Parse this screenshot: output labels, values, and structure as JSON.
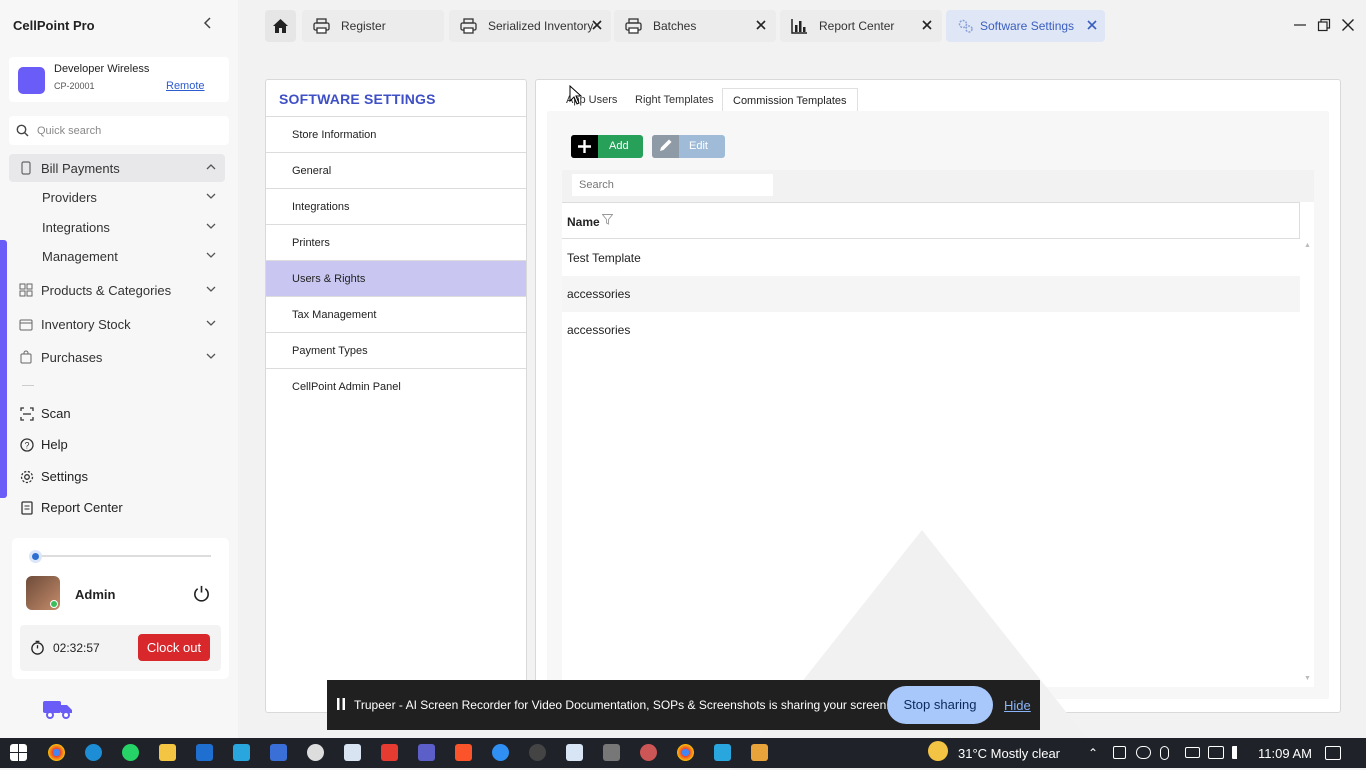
{
  "app": {
    "title": "CellPoint Pro"
  },
  "store": {
    "name": "Developer Wireless",
    "id": "CP-20001",
    "mode_link": "Remote"
  },
  "search": {
    "placeholder": "Quick search"
  },
  "nav": {
    "bill_payments": "Bill Payments",
    "providers": "Providers",
    "integrations": "Integrations",
    "management": "Management",
    "products": "Products & Categories",
    "inventory": "Inventory Stock",
    "purchases": "Purchases",
    "scan": "Scan",
    "help": "Help",
    "settings": "Settings",
    "report_center": "Report Center"
  },
  "user": {
    "name": "Admin",
    "timer": "02:32:57",
    "clock_out": "Clock out",
    "progress": 0.0
  },
  "tabs": [
    {
      "label": "Register",
      "icon": "printer-icon"
    },
    {
      "label": "Serialized Inventory",
      "icon": "printer-icon"
    },
    {
      "label": "Batches",
      "icon": "printer-icon"
    },
    {
      "label": "Report Center",
      "icon": "bar-chart-icon"
    },
    {
      "label": "Software Settings",
      "icon": "gears-icon"
    }
  ],
  "settings": {
    "title": "SOFTWARE SETTINGS",
    "items": [
      "Store Information",
      "General",
      "Integrations",
      "Printers",
      "Users & Rights",
      "Tax Management",
      "Payment Types",
      "CellPoint Admin Panel"
    ],
    "active": "Users & Rights"
  },
  "content": {
    "subtabs": [
      "App Users",
      "Right Templates",
      "Commission Templates"
    ],
    "active_subtab": "Commission Templates",
    "add_label": "Add",
    "edit_label": "Edit",
    "grid_search_placeholder": "Search",
    "column_name": "Name",
    "rows": [
      "Test Template",
      "accessories",
      "accessories"
    ]
  },
  "sharebar": {
    "message": "Trupeer - AI Screen Recorder for Video Documentation, SOPs & Screenshots is sharing your screen.",
    "stop_label": "Stop sharing",
    "hide_label": "Hide"
  },
  "taskbar": {
    "weather": "31°C  Mostly clear",
    "time": "11:09 AM"
  },
  "colors": {
    "accent": "#6a5cf6",
    "title_blue": "#3f50c6",
    "active_item": "#c9c7f1",
    "add_green": "#27a05a",
    "clock_out_red": "#d8282c"
  }
}
